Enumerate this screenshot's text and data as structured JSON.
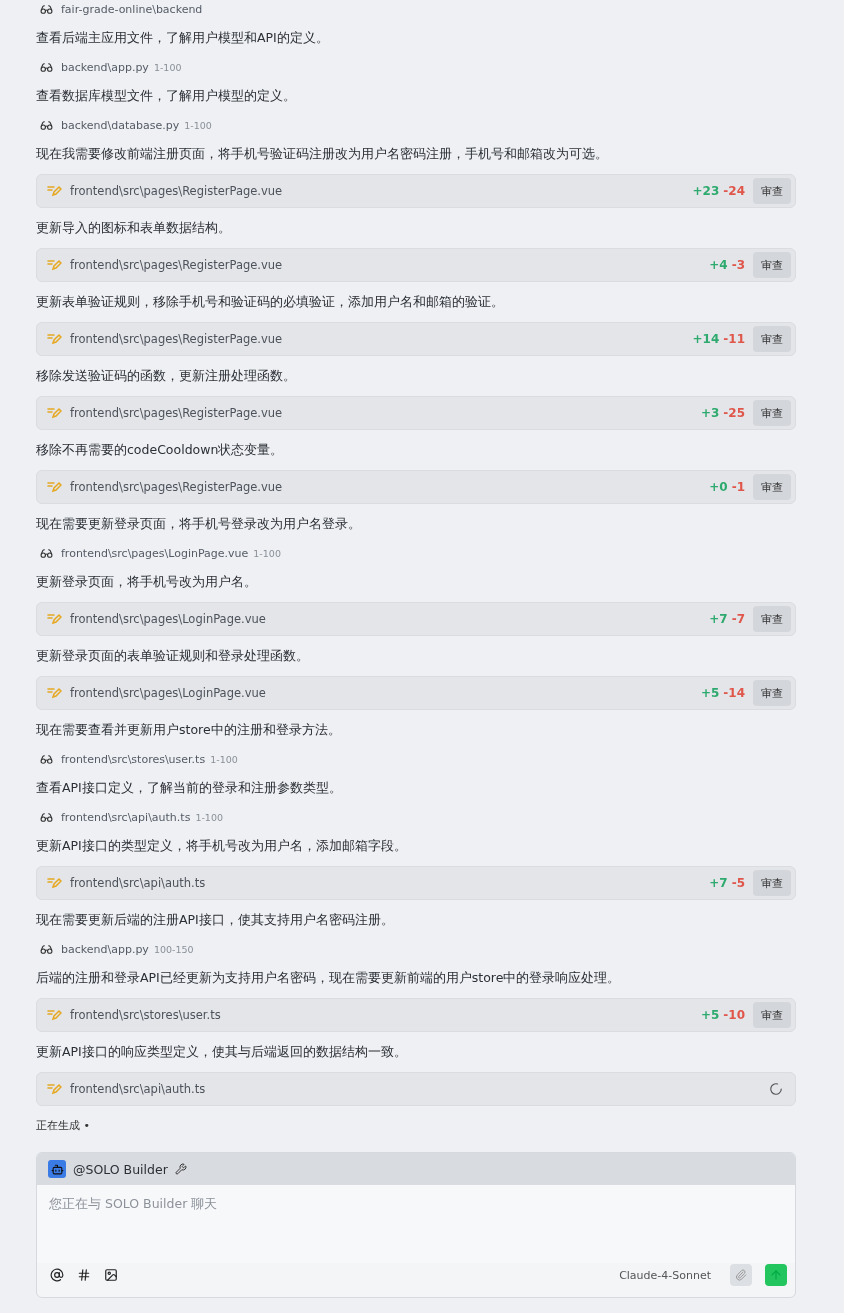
{
  "steps": [
    {
      "kind": "view",
      "path": "fair-grade-online\\backend"
    },
    {
      "kind": "text",
      "text": "查看后端主应用文件，了解用户模型和API的定义。"
    },
    {
      "kind": "view",
      "path": "backend\\app.py",
      "range": "1-100"
    },
    {
      "kind": "text",
      "text": "查看数据库模型文件，了解用户模型的定义。"
    },
    {
      "kind": "view",
      "path": "backend\\database.py",
      "range": "1-100"
    },
    {
      "kind": "text",
      "text": "现在我需要修改前端注册页面，将手机号验证码注册改为用户名密码注册，手机号和邮箱改为可选。"
    },
    {
      "kind": "edit",
      "path": "frontend\\src\\pages\\RegisterPage.vue",
      "added": "+23",
      "removed": "-24",
      "button": "审查",
      "pending": false
    },
    {
      "kind": "text",
      "text": "更新导入的图标和表单数据结构。"
    },
    {
      "kind": "edit",
      "path": "frontend\\src\\pages\\RegisterPage.vue",
      "added": "+4",
      "removed": "-3",
      "button": "审查",
      "pending": false
    },
    {
      "kind": "text",
      "text": "更新表单验证规则，移除手机号和验证码的必填验证，添加用户名和邮箱的验证。"
    },
    {
      "kind": "edit",
      "path": "frontend\\src\\pages\\RegisterPage.vue",
      "added": "+14",
      "removed": "-11",
      "button": "审查",
      "pending": false
    },
    {
      "kind": "text",
      "text": "移除发送验证码的函数，更新注册处理函数。"
    },
    {
      "kind": "edit",
      "path": "frontend\\src\\pages\\RegisterPage.vue",
      "added": "+3",
      "removed": "-25",
      "button": "审查",
      "pending": false
    },
    {
      "kind": "text",
      "text": "移除不再需要的codeCooldown状态变量。"
    },
    {
      "kind": "edit",
      "path": "frontend\\src\\pages\\RegisterPage.vue",
      "added": "+0",
      "removed": "-1",
      "button": "审查",
      "pending": false
    },
    {
      "kind": "text",
      "text": "现在需要更新登录页面，将手机号登录改为用户名登录。"
    },
    {
      "kind": "view",
      "path": "frontend\\src\\pages\\LoginPage.vue",
      "range": "1-100"
    },
    {
      "kind": "text",
      "text": "更新登录页面，将手机号改为用户名。"
    },
    {
      "kind": "edit",
      "path": "frontend\\src\\pages\\LoginPage.vue",
      "added": "+7",
      "removed": "-7",
      "button": "审查",
      "pending": false
    },
    {
      "kind": "text",
      "text": "更新登录页面的表单验证规则和登录处理函数。"
    },
    {
      "kind": "edit",
      "path": "frontend\\src\\pages\\LoginPage.vue",
      "added": "+5",
      "removed": "-14",
      "button": "审查",
      "pending": false
    },
    {
      "kind": "text",
      "text": "现在需要查看并更新用户store中的注册和登录方法。"
    },
    {
      "kind": "view",
      "path": "frontend\\src\\stores\\user.ts",
      "range": "1-100"
    },
    {
      "kind": "text",
      "text": "查看API接口定义，了解当前的登录和注册参数类型。"
    },
    {
      "kind": "view",
      "path": "frontend\\src\\api\\auth.ts",
      "range": "1-100"
    },
    {
      "kind": "text",
      "text": "更新API接口的类型定义，将手机号改为用户名，添加邮箱字段。"
    },
    {
      "kind": "edit",
      "path": "frontend\\src\\api\\auth.ts",
      "added": "+7",
      "removed": "-5",
      "button": "审查",
      "pending": false
    },
    {
      "kind": "text",
      "text": "现在需要更新后端的注册API接口，使其支持用户名密码注册。"
    },
    {
      "kind": "view",
      "path": "backend\\app.py",
      "range": "100-150"
    },
    {
      "kind": "text",
      "text": "后端的注册和登录API已经更新为支持用户名密码，现在需要更新前端的用户store中的登录响应处理。"
    },
    {
      "kind": "edit",
      "path": "frontend\\src\\stores\\user.ts",
      "added": "+5",
      "removed": "-10",
      "button": "审查",
      "pending": false
    },
    {
      "kind": "text",
      "text": "更新API接口的响应类型定义，使其与后端返回的数据结构一致。"
    },
    {
      "kind": "edit",
      "path": "frontend\\src\\api\\auth.ts",
      "pending": true
    }
  ],
  "status": "正在生成 •",
  "composer": {
    "agent": "@SOLO Builder",
    "placeholder": "您正在与 SOLO Builder 聊天",
    "model": "Claude-4-Sonnet"
  }
}
